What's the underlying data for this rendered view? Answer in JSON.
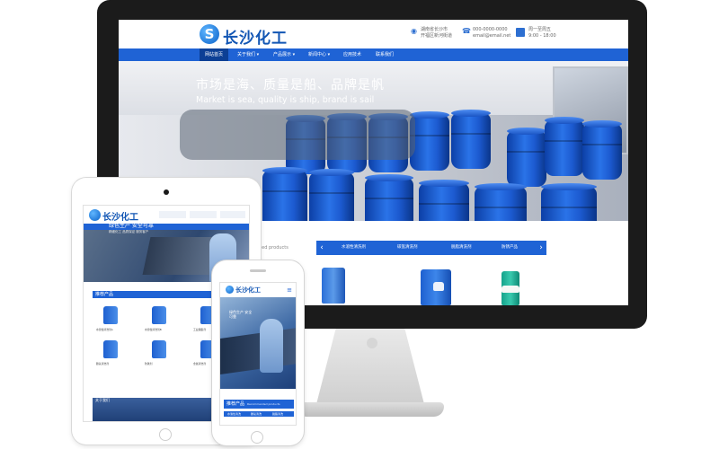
{
  "site": {
    "logo_letter": "S",
    "logo_text": "长沙化工",
    "address_line1": "湖南省长沙市",
    "address_line2": "开福区新河街道",
    "phone_line1": "000-0000-0000",
    "phone_line2": "email@email.net",
    "hours_line1": "周一至周五",
    "hours_line2": "9:00 - 18:00"
  },
  "nav": [
    "网站首页",
    "关于我们 ▾",
    "产品展示 ▾",
    "新闻中心 ▾",
    "应用技术",
    "联系我们"
  ],
  "banner": {
    "title_cn": "市场是海、质量是船、品牌是帆",
    "title_en": "Market is sea, quality is ship, brand is sail"
  },
  "products": {
    "title_en_fragment": "ded products",
    "tabs": [
      "水溶性清洗剂",
      "碳氢清洗剂",
      "脱脂清洗剂",
      "防锈产品"
    ]
  },
  "tablet": {
    "logo_text": "长沙化工",
    "banner_text": "绿色生产 安全可靠",
    "banner_sub": "精细化工 品质保证 服务客户",
    "section_label": "推荐产品",
    "items": [
      "水溶性清洗剂A",
      "水溶性清洗剂B",
      "工业脱脂剂",
      "碳氢清洗剂",
      "防锈剂",
      "金属清洗剂"
    ],
    "footer_label": "关于我们"
  },
  "phone": {
    "logo_text": "长沙化工",
    "menu": "≡",
    "banner_text": "绿色生产 安全可靠",
    "section_label": "推荐产品",
    "section_sub": "Recommended products",
    "tabs": [
      "水溶性清洗",
      "碳氢清洗",
      "脱脂清洗"
    ]
  },
  "colors": {
    "brand_blue": "#1f63d5",
    "nav_active": "#0c3f95",
    "logo_blue": "#1256b4"
  },
  "icons": {
    "location": "location-pin-icon",
    "phone": "phone-icon",
    "calendar": "calendar-icon",
    "prev": "chevron-left-icon",
    "next": "chevron-right-icon",
    "menu": "hamburger-menu-icon"
  }
}
